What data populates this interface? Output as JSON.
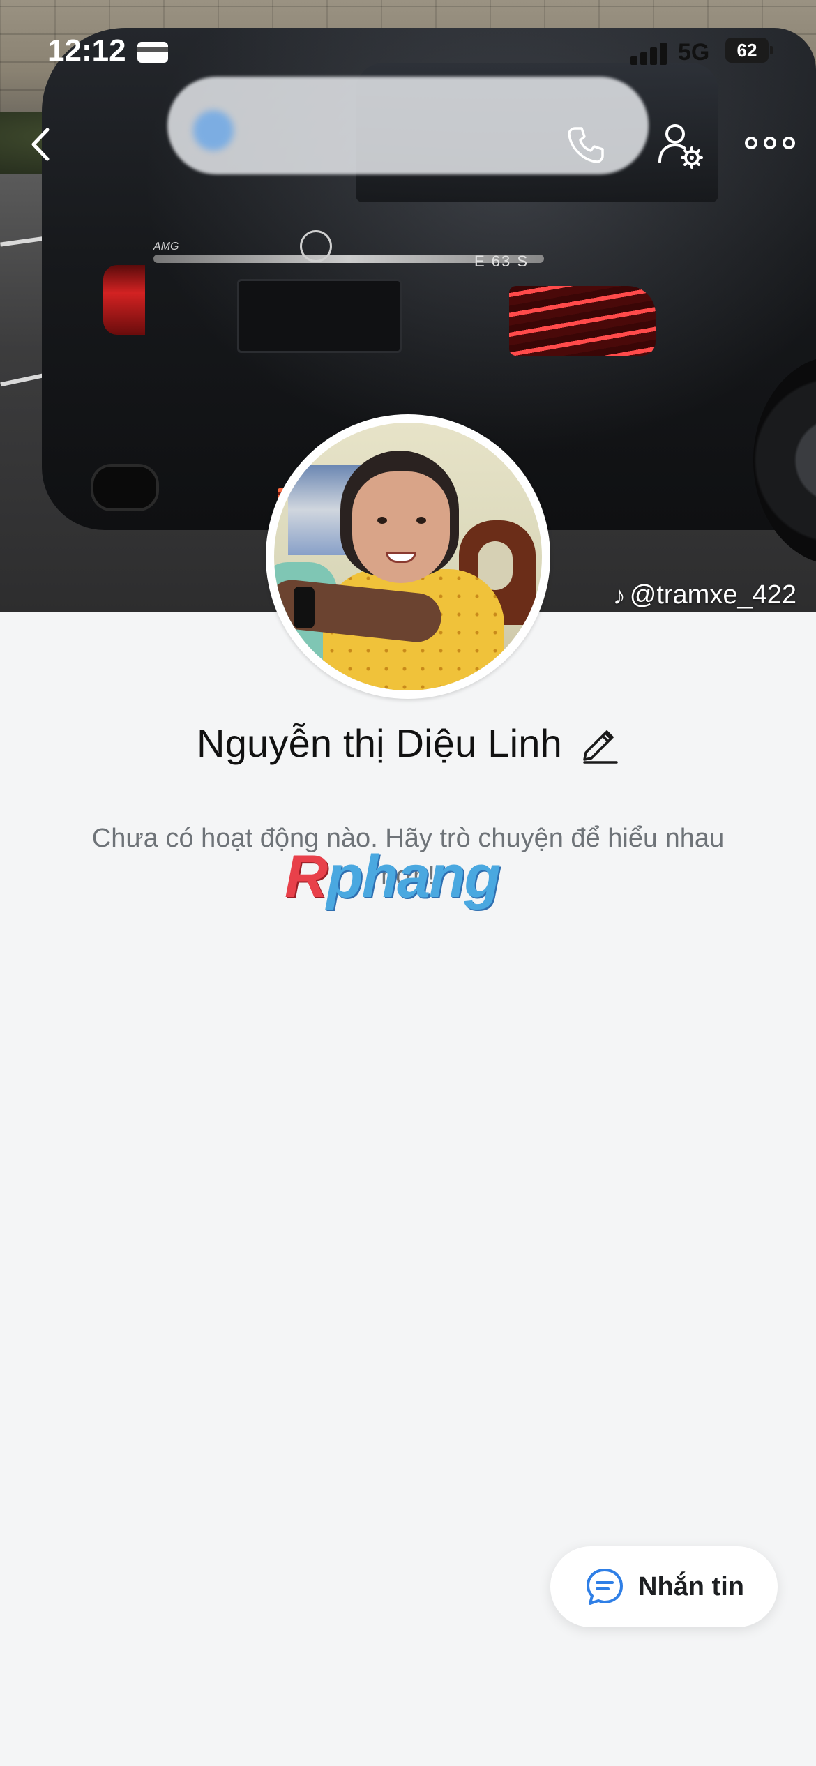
{
  "status_bar": {
    "time": "12:12",
    "network": "5G",
    "battery": "62"
  },
  "cover": {
    "tiktok_handle": "@tramxe_422",
    "car_badge": "E 63 S",
    "car_brand_mark": "AMG"
  },
  "nav": {
    "back_icon": "chevron-left-icon",
    "call_icon": "phone-icon",
    "settings_icon": "user-gear-icon",
    "more_icon": "more-horizontal-icon"
  },
  "profile": {
    "name": "Nguyễn thị Diệu Linh",
    "edit_icon": "pencil-icon",
    "empty_message": "Chưa có hoạt động nào. Hãy trò chuyện để hiểu nhau hơn!"
  },
  "watermark": {
    "first": "R",
    "rest": "phang"
  },
  "actions": {
    "message_label": "Nhắn tin",
    "message_icon": "chat-bubble-icon"
  },
  "colors": {
    "accent": "#2f7fe6",
    "background": "#f4f5f6",
    "text_primary": "#111111",
    "text_secondary": "#6e7378"
  }
}
